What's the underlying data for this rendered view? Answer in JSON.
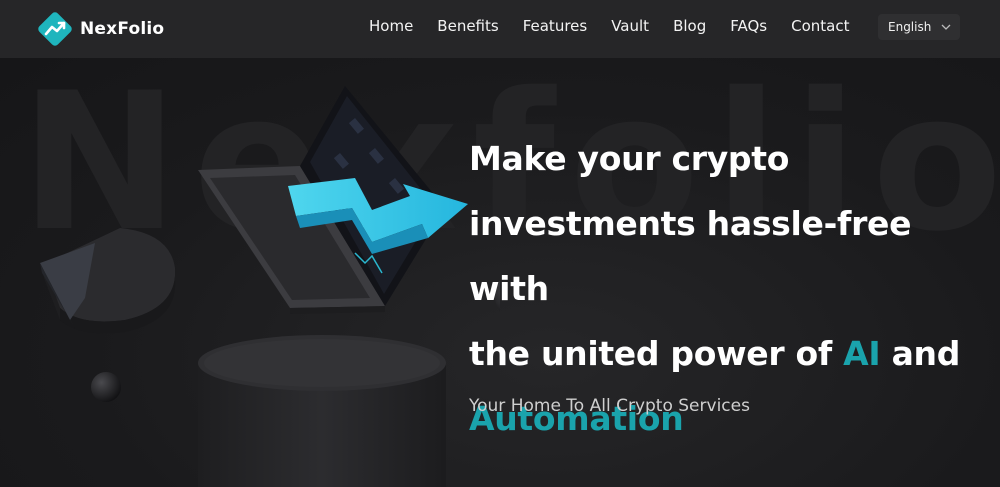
{
  "brand": {
    "name": "NexFolio",
    "logo_icon": "nexfolio-logo-icon",
    "accent_color": "#1fb5bd"
  },
  "nav": {
    "items": [
      {
        "label": "Home"
      },
      {
        "label": "Benefits"
      },
      {
        "label": "Features"
      },
      {
        "label": "Vault"
      },
      {
        "label": "Blog"
      },
      {
        "label": "FAQs"
      },
      {
        "label": "Contact"
      }
    ],
    "language": {
      "selected": "English",
      "icon": "chevron-down-icon"
    }
  },
  "hero": {
    "watermark": "Nexfolio",
    "headline": {
      "part1": "Make your crypto",
      "part2": "investments hassle-free with",
      "part3": "the united power of ",
      "highlight1": "AI",
      "part4": " and",
      "highlight2": "Automation"
    },
    "subtitle": "Your Home To All Crypto Services",
    "highlight_color": "#1aa3ac"
  }
}
